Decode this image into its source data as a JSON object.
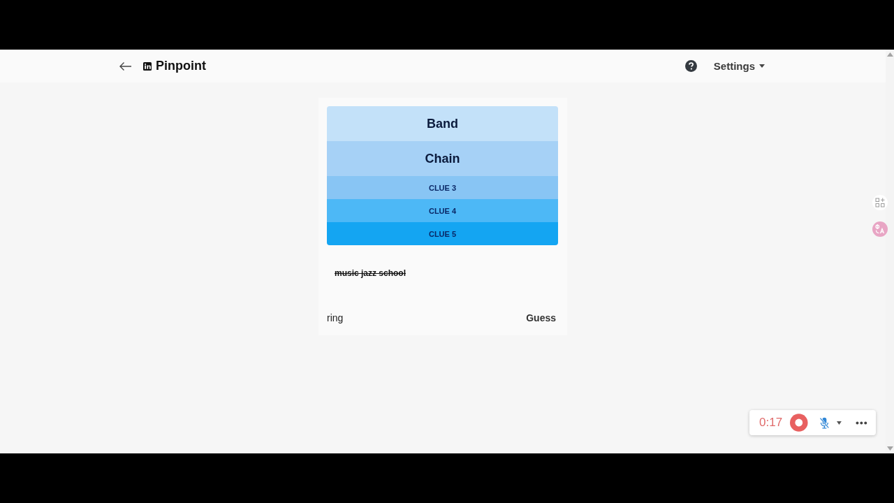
{
  "header": {
    "title": "Pinpoint",
    "settings_label": "Settings"
  },
  "clues": [
    {
      "text": "Band",
      "revealed": true,
      "color": "#c3e1f9"
    },
    {
      "text": "Chain",
      "revealed": true,
      "color": "#a6d1f6"
    },
    {
      "text": "CLUE 3",
      "revealed": false,
      "color": "#88c5f4"
    },
    {
      "text": "CLUE 4",
      "revealed": false,
      "color": "#4db8f6"
    },
    {
      "text": "CLUE 5",
      "revealed": false,
      "color": "#14a5f2"
    }
  ],
  "guesses": [
    {
      "text": "music jazz school",
      "incorrect": true
    }
  ],
  "guess_input": {
    "value": "ring"
  },
  "guess_button": "Guess",
  "recorder": {
    "time": "0:17",
    "mic_muted": true
  }
}
